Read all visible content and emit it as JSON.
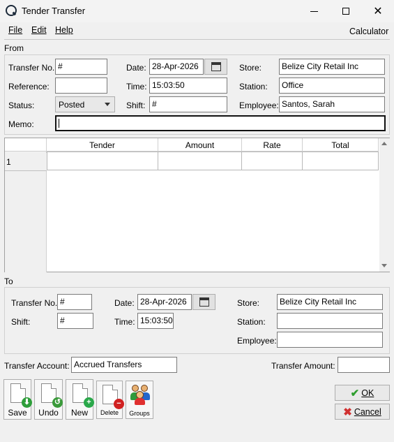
{
  "window": {
    "title": "Tender Transfer"
  },
  "menu": {
    "file": "File",
    "edit": "Edit",
    "help": "Help",
    "calculator": "Calculator"
  },
  "from": {
    "section_label": "From",
    "transfer_no_label": "Transfer No.",
    "transfer_no": "#",
    "reference_label": "Reference:",
    "reference": "",
    "status_label": "Status:",
    "status": "Posted",
    "memo_label": "Memo:",
    "memo": "",
    "date_label": "Date:",
    "date": "28-Apr-2026",
    "time_label": "Time:",
    "time": "15:03:50",
    "shift_label": "Shift:",
    "shift": "#",
    "store_label": "Store:",
    "store": "Belize City Retail Inc",
    "station_label": "Station:",
    "station": "Office",
    "employee_label": "Employee:",
    "employee": "Santos, Sarah"
  },
  "grid": {
    "columns": [
      "Tender",
      "Amount",
      "Rate",
      "Total"
    ],
    "rows": [
      {
        "num": "1",
        "tender": "",
        "amount": "",
        "rate": "",
        "total": ""
      }
    ]
  },
  "to": {
    "section_label": "To",
    "transfer_no_label": "Transfer No.",
    "transfer_no": "#",
    "shift_label": "Shift:",
    "shift": "#",
    "date_label": "Date:",
    "date": "28-Apr-2026",
    "time_label": "Time:",
    "time": "15:03:50",
    "store_label": "Store:",
    "store": "Belize City Retail Inc",
    "station_label": "Station:",
    "station": "",
    "employee_label": "Employee:",
    "employee": ""
  },
  "footer": {
    "transfer_account_label": "Transfer Account:",
    "transfer_account": "Accrued Transfers",
    "transfer_amount_label": "Transfer Amount:",
    "transfer_amount": ""
  },
  "toolbar": {
    "save": "Save",
    "undo": "Undo",
    "new": "New",
    "delete": "Delete",
    "groups": "Groups"
  },
  "buttons": {
    "ok": "OK",
    "cancel": "Cancel"
  },
  "colors": {
    "save_badge": "#2e9e3a",
    "undo_badge": "#3a9a3a",
    "new_badge": "#2aa84a",
    "delete_badge": "#d02020",
    "ok_check": "#2e9e2e",
    "cancel_x": "#d03030"
  }
}
